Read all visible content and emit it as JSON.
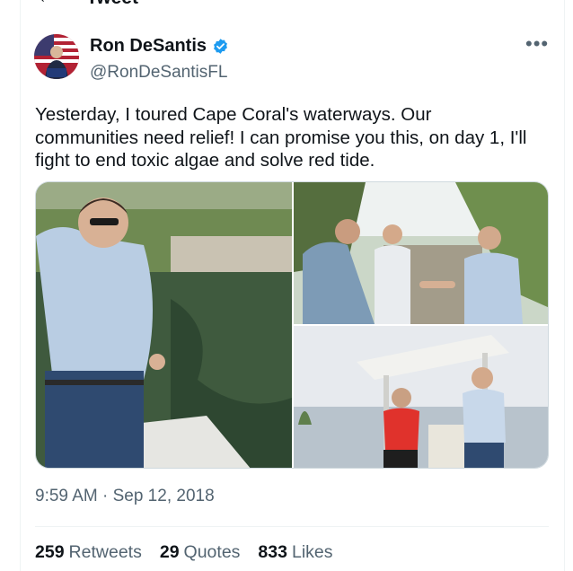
{
  "header": {
    "title": "Tweet",
    "back_icon": "arrow-left-icon"
  },
  "author": {
    "display_name": "Ron DeSantis",
    "handle": "@RonDeSantisFL",
    "verified_icon": "verified-badge-icon",
    "verified_color": "#1d9bf0"
  },
  "tweet": {
    "text": "Yesterday, I toured Cape Coral's waterways. Our communities need relief! I can promise you this, on day 1, I'll fight to end toxic algae and solve red tide.",
    "timestamp": "9:59 AM · Sep 12, 2018",
    "more_icon": "ellipsis-icon"
  },
  "stats": {
    "retweets_count": "259",
    "retweets_label": "Retweets",
    "quotes_count": "29",
    "quotes_label": "Quotes",
    "likes_count": "833",
    "likes_label": "Likes"
  },
  "colors": {
    "text_primary": "#0f1419",
    "text_secondary": "#536471",
    "border": "#eff3f4"
  }
}
